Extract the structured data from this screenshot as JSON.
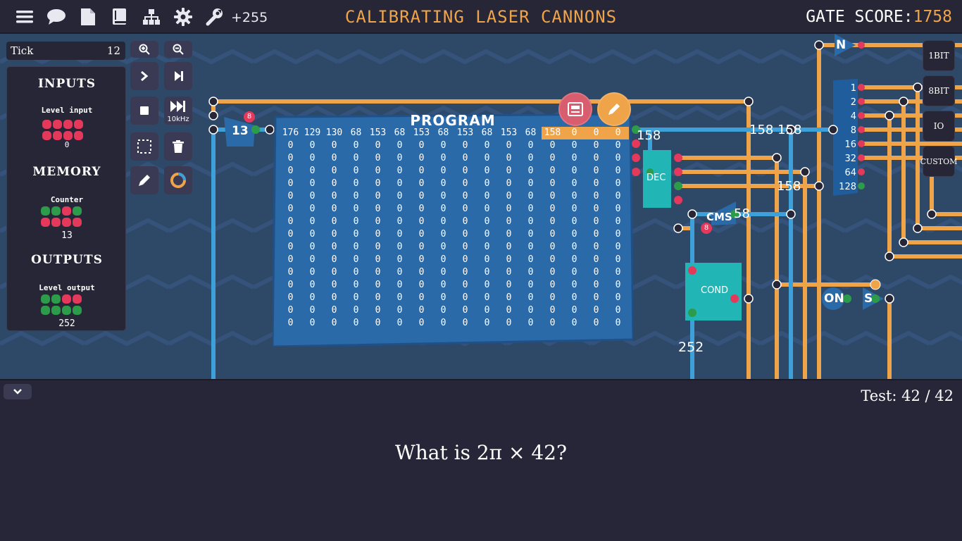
{
  "topbar": {
    "plus_count": "+255",
    "title": "CALIBRATING LASER CANNONS",
    "gate_score_label": "GATE SCORE:",
    "gate_score_value": "1758"
  },
  "tick": {
    "label": "Tick",
    "value": "12"
  },
  "panel": {
    "inputs_title": "INPUTS",
    "level_input_label": "Level input",
    "level_input_value": "0",
    "memory_title": "MEMORY",
    "counter_label": "Counter",
    "counter_value": "13",
    "outputs_title": "OUTPUTS",
    "level_output_label": "Level output",
    "level_output_value": "252"
  },
  "toolbar": {
    "speed_label": "10kHz"
  },
  "program": {
    "title": "PROGRAM",
    "first_row": [
      "176",
      "129",
      "130",
      "68",
      "153",
      "68",
      "153",
      "68",
      "153",
      "68",
      "153",
      "68",
      "158",
      "0",
      "0",
      "0"
    ],
    "highlight_from": 12,
    "zero_rows": 15
  },
  "board": {
    "counter_node": "13",
    "wire_158_a": "158",
    "wire_158_b": "158 158",
    "wire_158_c": "158",
    "wire_158_d": "58",
    "dec_label": "DEC",
    "cond_label": "COND",
    "cms_label": "CMS",
    "out_252": "252",
    "on_label": "ON",
    "s_label": "S",
    "n_label": "N",
    "badge_8": "8",
    "bits_labels": [
      "1",
      "2",
      "4",
      "8",
      "16",
      "32",
      "64",
      "128"
    ]
  },
  "side_buttons": [
    "1BIT",
    "8BIT",
    "IO",
    "CUSTOM"
  ],
  "bottom": {
    "test_label": "Test: 42 / 42",
    "question": "What is 2π × 42?"
  },
  "colors": {
    "orange": "#f0a44a",
    "blue": "#3da0d8",
    "red": "#e5395c",
    "green": "#2d9c4a",
    "teal": "#22b5b5"
  }
}
